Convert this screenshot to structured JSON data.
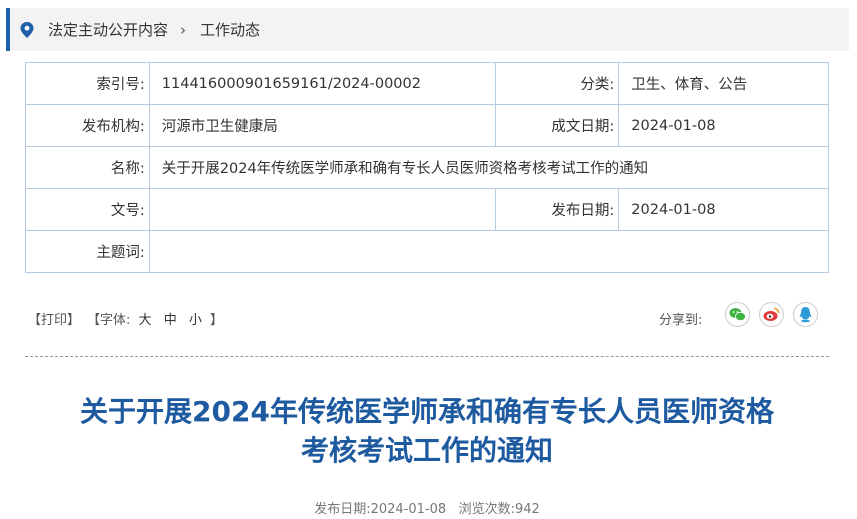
{
  "breadcrumb": {
    "items": [
      "法定主动公开内容",
      "工作动态"
    ],
    "separator": "›"
  },
  "meta": {
    "index_no_label": "索引号:",
    "index_no_value": "114416000901659161/2024-00002",
    "category_label": "分类:",
    "category_value": "卫生、体育、公告",
    "publisher_label": "发布机构:",
    "publisher_value": "河源市卫生健康局",
    "written_date_label": "成文日期:",
    "written_date_value": "2024-01-08",
    "name_label": "名称:",
    "name_value": "关于开展2024年传统医学师承和确有专长人员医师资格考核考试工作的通知",
    "doc_no_label": "文号:",
    "doc_no_value": "",
    "publish_date_label": "发布日期:",
    "publish_date_value": "2024-01-08",
    "subject_label": "主题词:",
    "subject_value": ""
  },
  "toolbar": {
    "print": "【打印】",
    "font_prefix": "【字体:",
    "font_large": "大",
    "font_medium": "中",
    "font_small": "小",
    "font_suffix": "】",
    "share_label": "分享到:"
  },
  "article": {
    "title_line1": "关于开展2024年传统医学师承和确有专长人员医师资格",
    "title_line2": "考核考试工作的通知",
    "publish_date_label": "发布日期:",
    "publish_date": "2024-01-08",
    "views_label": "浏览次数:",
    "views": "942"
  },
  "colors": {
    "accent": "#1f5fa9",
    "title": "#1e5aa0",
    "wechat": "#3fb33f",
    "weibo": "#e2393a",
    "qq": "#2e9bd6"
  }
}
